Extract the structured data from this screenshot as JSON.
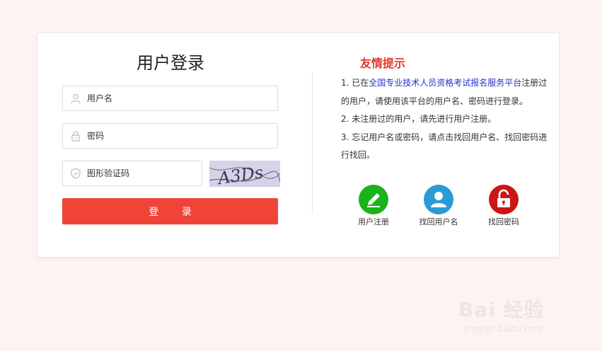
{
  "login": {
    "title": "用户登录",
    "username_placeholder": "用户名",
    "password_placeholder": "密码",
    "captcha_placeholder": "图形验证码",
    "captcha_text": "A3Ds",
    "login_button": "登 录"
  },
  "tips": {
    "title": "友情提示",
    "item1_prefix": "1. 已在",
    "item1_link": "全国专业技术人员资格考试报名服务平台",
    "item1_suffix": "注册过的用户，请使用该平台的用户名、密码进行登录。",
    "item2": "2. 未注册过的用户，请先进行用户注册。",
    "item3": "3. 忘记用户名或密码，请点击找回用户名、找回密码进行找回。"
  },
  "quick_actions": [
    {
      "label": "用户注册",
      "color": "#1bb21a",
      "icon": "pencil-icon"
    },
    {
      "label": "找回用户名",
      "color": "#2a9bd6",
      "icon": "user-icon"
    },
    {
      "label": "找回密码",
      "color": "#cc1616",
      "icon": "lock-icon"
    }
  ],
  "watermark": {
    "brand": "Bai 经验",
    "url": "jingyan.baidu.com"
  },
  "colors": {
    "primary": "#f04438",
    "tips_title": "#e2382c",
    "link": "#2233cc",
    "background": "#fdf4f2"
  }
}
